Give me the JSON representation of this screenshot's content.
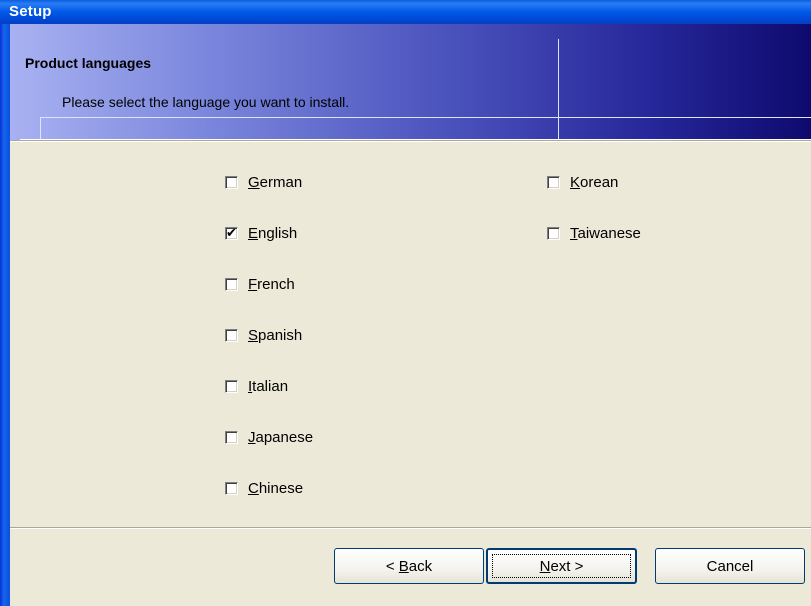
{
  "window": {
    "title": "Setup"
  },
  "header": {
    "title": "Product languages",
    "subtitle": "Please select the language you want to install."
  },
  "languages": {
    "left": [
      {
        "label": "German",
        "accel": "G",
        "rest": "erman",
        "checked": false
      },
      {
        "label": "English",
        "accel": "E",
        "rest": "nglish",
        "checked": true
      },
      {
        "label": "French",
        "accel": "F",
        "rest": "rench",
        "checked": false
      },
      {
        "label": "Spanish",
        "accel": "S",
        "rest": "panish",
        "checked": false
      },
      {
        "label": "Italian",
        "accel": "I",
        "rest": "talian",
        "checked": false
      },
      {
        "label": "Japanese",
        "accel": "J",
        "rest": "apanese",
        "checked": false
      },
      {
        "label": "Chinese",
        "accel": "C",
        "rest": "hinese",
        "checked": false
      }
    ],
    "right": [
      {
        "label": "Korean",
        "accel": "K",
        "rest": "orean",
        "checked": false
      },
      {
        "label": "Taiwanese",
        "accel": "T",
        "rest": "aiwanese",
        "checked": false
      }
    ]
  },
  "buttons": {
    "back_prefix": "< ",
    "back_accel": "B",
    "back_rest": "ack",
    "next_accel": "N",
    "next_rest": "ext >",
    "cancel": "Cancel"
  },
  "colors": {
    "titlebar": "#0058e6",
    "header_gradient_start": "#a8b2f2",
    "header_gradient_end": "#0e0a6e",
    "dialog_bg": "#ece9d8"
  }
}
